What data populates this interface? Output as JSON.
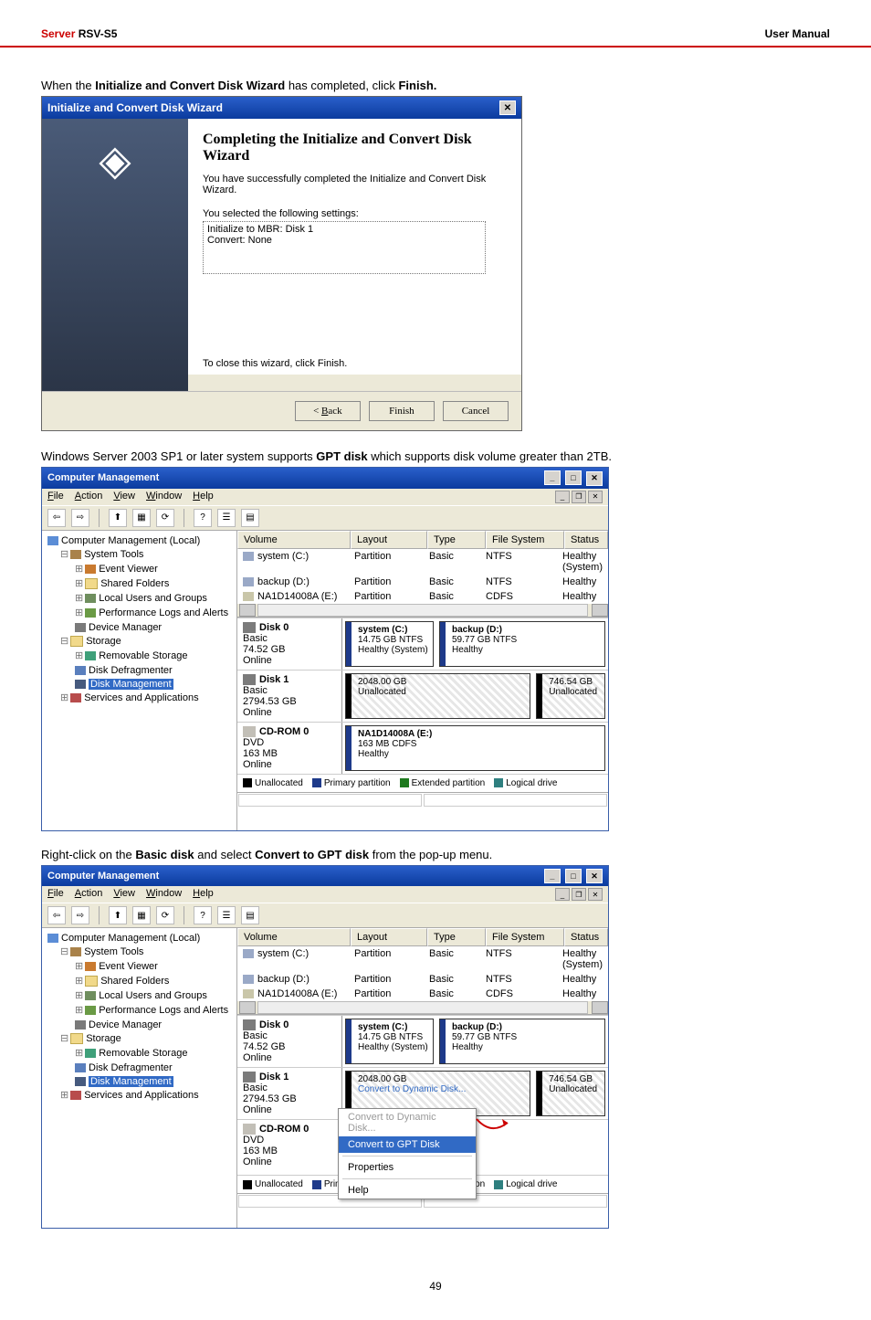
{
  "header": {
    "brand": "Server",
    "model": "RSV-S5",
    "manual": "User Manual"
  },
  "intro1_pre": "When the ",
  "intro1_bold": "Initialize and Convert Disk Wizard",
  "intro1_mid": " has completed, click ",
  "intro1_bold2": "Finish.",
  "wizard": {
    "title": "Initialize and Convert Disk Wizard",
    "heading": "Completing the Initialize and Convert Disk Wizard",
    "sub": "You have successfully completed the Initialize and Convert Disk Wizard.",
    "sel_label": "You selected the following settings:",
    "sel_text": "Initialize to MBR: Disk 1\nConvert: None",
    "close_hint": "To close this wizard, click Finish.",
    "back": "< Back",
    "back_u": "B",
    "finish": "Finish",
    "cancel": "Cancel"
  },
  "gpt_pre": "Windows Server 2003 SP1 or later system supports ",
  "gpt_bold": "GPT disk",
  "gpt_post": " which supports disk volume greater than 2TB.",
  "mmc": {
    "title": "Computer Management",
    "menu": {
      "file": "File",
      "action": "Action",
      "view": "View",
      "window": "Window",
      "help": "Help",
      "file_u": "F",
      "action_u": "A",
      "view_u": "V",
      "window_u": "W",
      "help_u": "H"
    },
    "tree": {
      "root": "Computer Management (Local)",
      "systools": "System Tools",
      "ev": "Event Viewer",
      "sf": "Shared Folders",
      "lu": "Local Users and Groups",
      "perf": "Performance Logs and Alerts",
      "dev": "Device Manager",
      "storage": "Storage",
      "rem": "Removable Storage",
      "defrag": "Disk Defragmenter",
      "dm": "Disk Management",
      "serv": "Services and Applications"
    },
    "cols": {
      "vol": "Volume",
      "layout": "Layout",
      "type": "Type",
      "fs": "File System",
      "status": "Status"
    },
    "vols": [
      {
        "vol": "system (C:)",
        "layout": "Partition",
        "type": "Basic",
        "fs": "NTFS",
        "status": "Healthy (System)",
        "icon": "hd"
      },
      {
        "vol": "backup (D:)",
        "layout": "Partition",
        "type": "Basic",
        "fs": "NTFS",
        "status": "Healthy",
        "icon": "hd"
      },
      {
        "vol": "NA1D14008A (E:)",
        "layout": "Partition",
        "type": "Basic",
        "fs": "CDFS",
        "status": "Healthy",
        "icon": "cd"
      }
    ],
    "disk0": {
      "label": "Disk 0",
      "kind": "Basic",
      "size": "74.52 GB",
      "state": "Online",
      "p1": {
        "name": "system  (C:)",
        "line2": "14.75 GB NTFS",
        "line3": "Healthy (System)"
      },
      "p2": {
        "name": "backup  (D:)",
        "line2": "59.77 GB NTFS",
        "line3": "Healthy"
      }
    },
    "disk1": {
      "label": "Disk 1",
      "kind": "Basic",
      "size": "2794.53 GB",
      "state": "Online",
      "p1": {
        "line1": "2048.00 GB",
        "line2": "Unallocated"
      },
      "p2": {
        "line1": "746.54 GB",
        "line2": "Unallocated"
      }
    },
    "cd0": {
      "label": "CD-ROM 0",
      "kind": "DVD",
      "size": "163 MB",
      "state": "Online",
      "p1": {
        "name": "NA1D14008A (E:)",
        "line2": "163 MB CDFS",
        "line3": "Healthy"
      }
    },
    "legend": {
      "un": "Unallocated",
      "pp": "Primary partition",
      "ep": "Extended partition",
      "ld": "Logical drive"
    }
  },
  "diskB": {
    "p1_line1": "2048.00 GB",
    "p1_line2": "Convert to Dynamic Disk..."
  },
  "ctx": {
    "dyn": "Convert to Dynamic Disk...",
    "gpt": "Convert to GPT Disk",
    "prop": "Properties",
    "help": "Help",
    "help_u": "H"
  },
  "right_pre": "Right-click on the ",
  "right_b1": "Basic disk",
  "right_mid": " and select ",
  "right_b2": "Convert to GPT disk",
  "right_post": " from the pop-up menu.",
  "pagenum": "49"
}
